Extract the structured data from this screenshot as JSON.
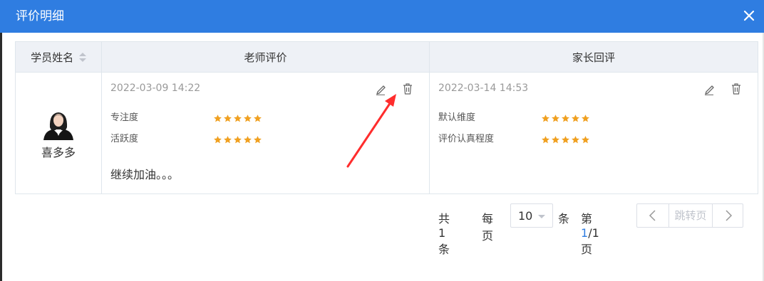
{
  "dialog": {
    "title": "评价明细"
  },
  "table": {
    "headers": {
      "student": "学员姓名",
      "teacher": "老师评价",
      "parent": "家长回评"
    },
    "row": {
      "student_name": "喜多多",
      "teacher": {
        "date": "2022-03-09 14:22",
        "items": [
          {
            "label": "专注度",
            "rating": 5
          },
          {
            "label": "活跃度",
            "rating": 5
          }
        ],
        "comment": "继续加油。。。"
      },
      "parent": {
        "date": "2022-03-14 14:53",
        "items": [
          {
            "label": "默认维度",
            "rating": 5
          },
          {
            "label": "评价认真程度",
            "rating": 5
          }
        ]
      }
    }
  },
  "pagination": {
    "total_text": "共1条",
    "per_page_label": "每页",
    "page_size": "10",
    "unit": "条",
    "page_prefix": "第",
    "current_page": "1",
    "page_suffix": "/1页",
    "jump_label": "跳转页"
  },
  "colors": {
    "header_blue": "#2f7de1",
    "star": "#f0a020",
    "annotation_arrow": "#ff2d2d"
  }
}
